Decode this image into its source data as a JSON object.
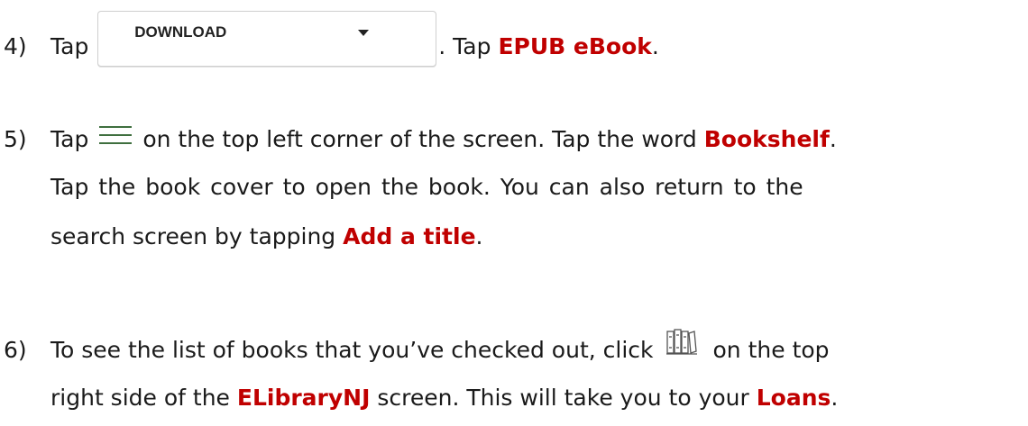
{
  "step4": {
    "number": "4)",
    "text_before": "Tap",
    "button_label": "DOWNLOAD",
    "text_middle": ". Tap ",
    "highlight": "EPUB eBook",
    "text_after": "."
  },
  "step5": {
    "number": "5)",
    "text_before": "Tap",
    "text_1": "on the top left corner of the screen.  Tap the word ",
    "highlight_1": "Bookshelf",
    "text_2": ".",
    "line2": "Tap the book cover to open the book.  You can also return to the",
    "line3_before": "search screen by tapping ",
    "highlight_2": "Add a title",
    "line3_after": "."
  },
  "step6": {
    "number": "6)",
    "text_before": "To see the list of books that you’ve checked out, click",
    "text_after_icon": "on the top",
    "line2_before": "right side of the ",
    "highlight_1": "ELibraryNJ",
    "line2_middle": " screen.  This will take you to your ",
    "highlight_2": "Loans",
    "line2_after": "."
  },
  "colors": {
    "highlight": "#c00000",
    "menu_icon": "#3f6f3f"
  },
  "icons": [
    "hamburger-menu-icon",
    "bookshelf-icon",
    "dropdown-caret-icon"
  ]
}
